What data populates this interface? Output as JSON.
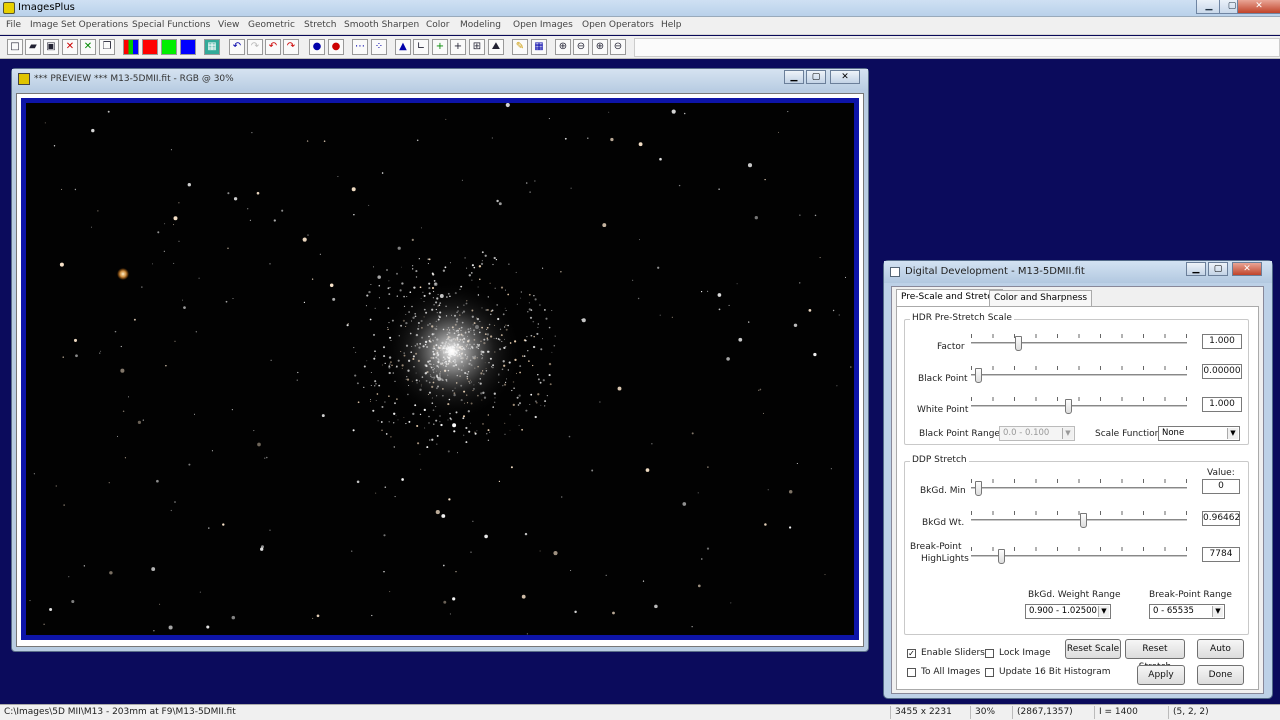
{
  "app": {
    "title": "ImagesPlus"
  },
  "menu": [
    "File",
    "Image Set Operations",
    "Special Functions",
    "View",
    "Geometric",
    "Stretch",
    "Smooth Sharpen",
    "Color",
    "Modeling",
    "Open Images",
    "Open Operators",
    "Help"
  ],
  "preview": {
    "title": "*** PREVIEW *** M13-5DMII.fit - RGB @ 30%"
  },
  "dialog": {
    "title": "Digital Development - M13-5DMII.fit",
    "tabs": [
      "Pre-Scale and Stretch",
      "Color and Sharpness"
    ],
    "hdr": {
      "group_label": "HDR Pre-Stretch Scale",
      "factor": {
        "label": "Factor",
        "value": "1.000",
        "pos": 0.21
      },
      "black_point": {
        "label": "Black Point",
        "value": "0.00000",
        "pos": 0.02
      },
      "white_point": {
        "label": "White Point",
        "value": "1.000",
        "pos": 0.45
      },
      "black_point_range": {
        "label": "Black Point Range",
        "value": "0.0 - 0.100"
      },
      "scale_function": {
        "label": "Scale Function",
        "value": "None"
      }
    },
    "ddp": {
      "group_label": "DDP Stretch",
      "value_header": "Value:",
      "bkgd_min": {
        "label": "BkGd. Min",
        "value": "0",
        "pos": 0.02
      },
      "bkgd_wt": {
        "label": "BkGd Wt.",
        "value": "0.96462",
        "pos": 0.52
      },
      "breakpoint": {
        "label1": "Break-Point",
        "label2": "HighLights",
        "value": "7784",
        "pos": 0.13
      },
      "weight_range": {
        "label": "BkGd. Weight Range",
        "value": "0.900 - 1.02500"
      },
      "bp_range": {
        "label": "Break-Point Range",
        "value": "0 - 65535"
      }
    },
    "options": {
      "enable_sliders": "Enable Sliders",
      "lock_image": "Lock Image",
      "to_all_images": "To All Images",
      "update_16bit": "Update 16 Bit Histogram"
    },
    "buttons": {
      "reset_scale": "Reset Scale",
      "reset_stretch": "Reset Stretch",
      "auto": "Auto",
      "apply": "Apply",
      "done": "Done"
    }
  },
  "status": {
    "path": "C:\\Images\\5D MII\\M13 - 203mm at F9\\M13-5DMII.fit",
    "size": "3455 x 2231",
    "zoom": "30%",
    "coords": "(2867,1357)",
    "intensity": "I = 1400",
    "rgb": "(5, 2, 2)"
  },
  "colors": {
    "desktop": "#0b0b5c",
    "image_border": "#0d14a8",
    "accent": "#b9cde2"
  }
}
